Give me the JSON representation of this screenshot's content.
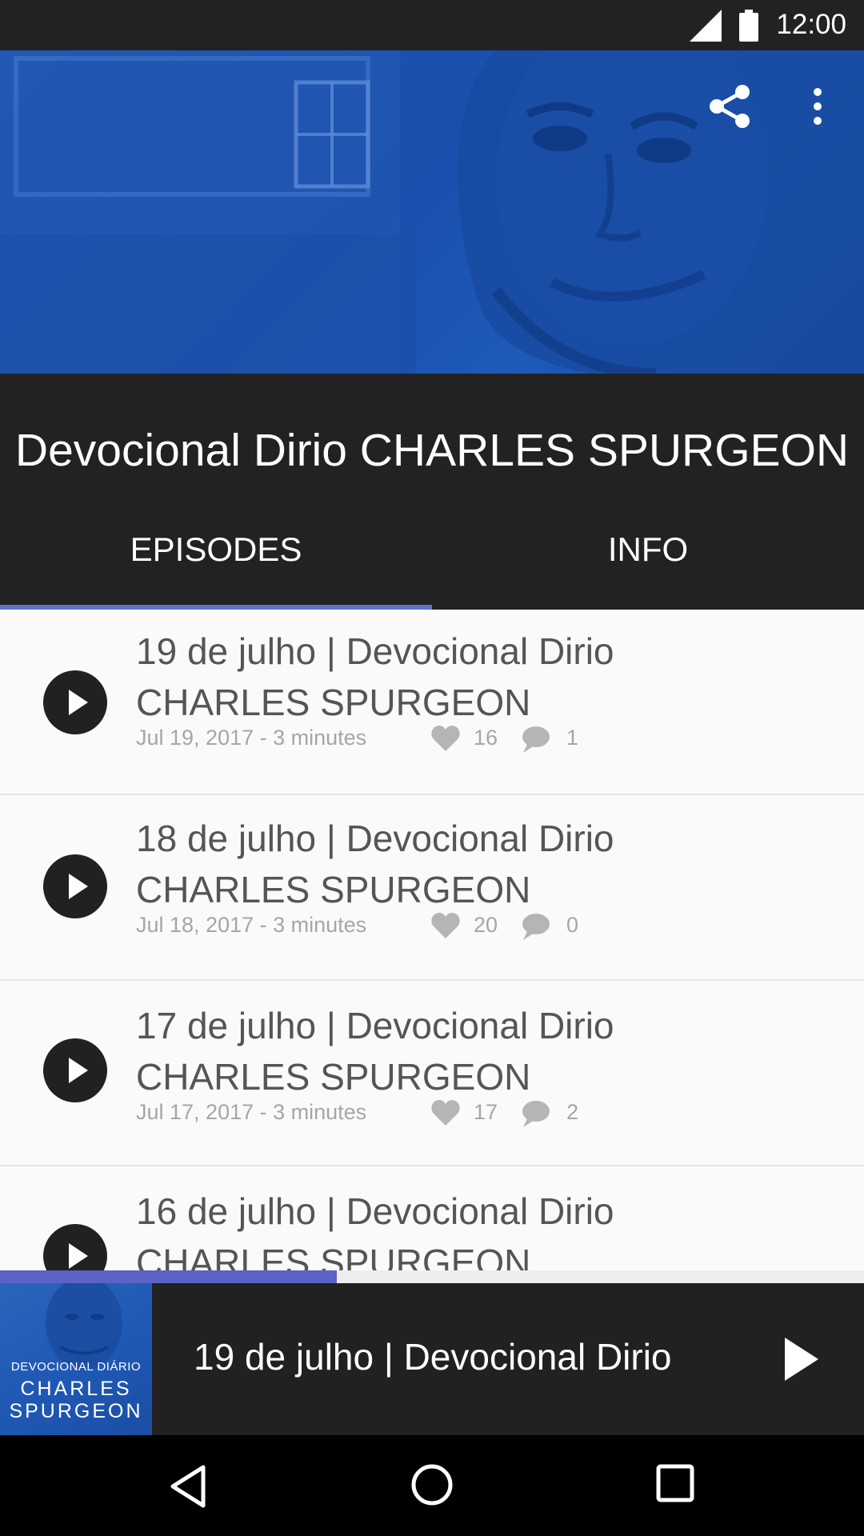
{
  "status_bar": {
    "time": "12:00"
  },
  "header": {
    "title": "Devocional Dirio CHARLES SPURGEON",
    "actions": [
      "share-icon",
      "more-vert-icon"
    ]
  },
  "tabs": [
    {
      "label": "EPISODES",
      "selected": true
    },
    {
      "label": "INFO",
      "selected": false
    }
  ],
  "episodes": [
    {
      "title_line1": "19 de julho | Devocional Dirio",
      "title_line2": "CHARLES SPURGEON",
      "meta": "Jul 19, 2017 - 3 minutes",
      "likes": "16",
      "comments": "1"
    },
    {
      "title_line1": "18 de julho | Devocional Dirio",
      "title_line2": "CHARLES SPURGEON",
      "meta": "Jul 18, 2017 - 3 minutes",
      "likes": "20",
      "comments": "0"
    },
    {
      "title_line1": "17 de julho | Devocional Dirio",
      "title_line2": "CHARLES SPURGEON",
      "meta": "Jul 17, 2017 - 3 minutes",
      "likes": "17",
      "comments": "2"
    },
    {
      "title_line1": "16 de julho | Devocional Dirio",
      "title_line2": "CHARLES SPURGEON"
    }
  ],
  "player": {
    "progress_fraction": 0.39,
    "title": "19 de julho | Devocional Dirio",
    "cover": {
      "line1": "DEVOCIONAL DIÁRIO",
      "line2": "CHARLES",
      "line3": "SPURGEON"
    }
  },
  "colors": {
    "accent": "#5b63c6",
    "header_blue": "#1f56b4",
    "bar_dark": "#222222"
  },
  "nav_bar": {
    "buttons": [
      "back-icon",
      "home-icon",
      "recents-icon"
    ]
  }
}
